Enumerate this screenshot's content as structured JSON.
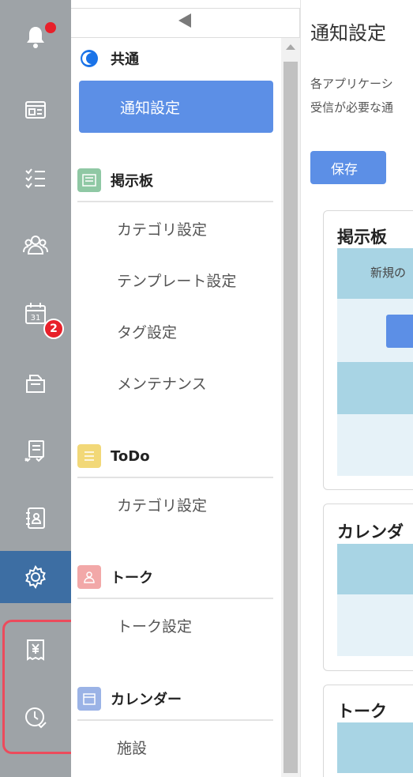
{
  "rail": {
    "items": [
      {
        "name": "bell-icon",
        "label": "notifications"
      },
      {
        "name": "bulletin-board-icon",
        "label": "bulletin board"
      },
      {
        "name": "checklist-icon",
        "label": "todo"
      },
      {
        "name": "people-icon",
        "label": "talk"
      },
      {
        "name": "calendar-icon",
        "label": "calendar",
        "calendar_day": "31"
      },
      {
        "name": "folder-icon",
        "label": "files"
      },
      {
        "name": "document-check-icon",
        "label": "reports"
      },
      {
        "name": "address-book-icon",
        "label": "address book"
      },
      {
        "name": "gear-icon",
        "label": "settings"
      },
      {
        "name": "receipt-yen-icon",
        "label": "expenses"
      },
      {
        "name": "clock-check-icon",
        "label": "attendance"
      }
    ],
    "calendar_badge": "2",
    "active_color": "#3d6ea3",
    "highlight_color": "#ec4b5c"
  },
  "menu": {
    "sections": [
      {
        "title": "共通",
        "icon": "moon-icon",
        "icon_color": "#1a73e8",
        "items": [
          {
            "label": "通知設定",
            "selected": true
          }
        ]
      },
      {
        "title": "掲示板",
        "icon": "bulletin-board-icon",
        "icon_color": "#8fc8a4",
        "items": [
          {
            "label": "カテゴリ設定"
          },
          {
            "label": "テンプレート設定"
          },
          {
            "label": "タグ設定"
          },
          {
            "label": "メンテナンス"
          }
        ]
      },
      {
        "title": "ToDo",
        "icon": "checklist-icon",
        "icon_color": "#f2d878",
        "items": [
          {
            "label": "カテゴリ設定"
          }
        ]
      },
      {
        "title": "トーク",
        "icon": "people-icon",
        "icon_color": "#f2a8a8",
        "items": [
          {
            "label": "トーク設定"
          }
        ]
      },
      {
        "title": "カレンダー",
        "icon": "calendar-icon",
        "icon_color": "#9bb3e6",
        "items": [
          {
            "label": "施設"
          }
        ]
      }
    ],
    "selected_color": "#5c8fe6"
  },
  "content": {
    "title": "通知設定",
    "description_line1": "各アプリケーシ",
    "description_line2": "受信が必要な通",
    "save_label": "保存",
    "cards": [
      {
        "title": "掲示板",
        "band_text": "新規の"
      },
      {
        "title": "カレンダ"
      },
      {
        "title": "トーク"
      }
    ]
  }
}
